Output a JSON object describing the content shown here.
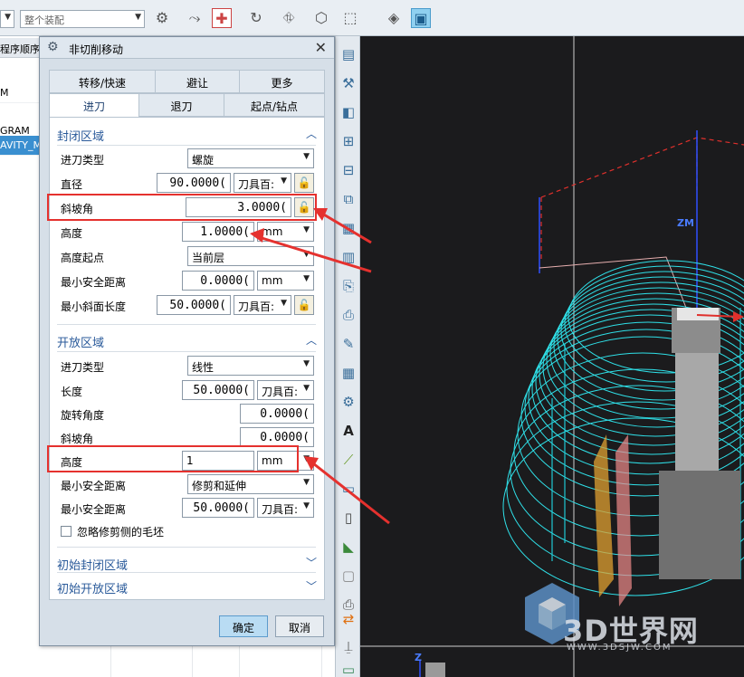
{
  "toolbar": {
    "combo_left_value": "",
    "combo_main_value": "整个装配"
  },
  "navigator": {
    "header": "程序顺序",
    "rows": [
      "M",
      "GRAM",
      "AVITY_M"
    ]
  },
  "dialog": {
    "title": "非切削移动",
    "tabs_row1": [
      "转移/快速",
      "避让",
      "更多"
    ],
    "tabs_row2": [
      "进刀",
      "退刀",
      "起点/钻点"
    ],
    "active_tab": "进刀",
    "closed_region": {
      "header": "封闭区域",
      "entry_type_label": "进刀类型",
      "entry_type_value": "螺旋",
      "diameter_label": "直径",
      "diameter_value": "90.0000(",
      "diameter_unit": "刀具百:",
      "ramp_angle_label": "斜坡角",
      "ramp_angle_value": "3.0000(",
      "height_label": "高度",
      "height_value": "1.0000(",
      "height_unit": "mm",
      "height_from_label": "高度起点",
      "height_from_value": "当前层",
      "min_safe_label": "最小安全距离",
      "min_safe_value": "0.0000(",
      "min_safe_unit": "mm",
      "min_ramp_label": "最小斜面长度",
      "min_ramp_value": "50.0000(",
      "min_ramp_unit": "刀具百:"
    },
    "open_region": {
      "header": "开放区域",
      "entry_type_label": "进刀类型",
      "entry_type_value": "线性",
      "length_label": "长度",
      "length_value": "50.0000(",
      "length_unit": "刀具百:",
      "rotation_label": "旋转角度",
      "rotation_value": "0.0000(",
      "ramp_angle_label": "斜坡角",
      "ramp_angle_value": "0.0000(",
      "height_label": "高度",
      "height_value": "1",
      "height_unit": "mm",
      "min_safe_label": "最小安全距离",
      "min_safe_value": "修剪和延伸",
      "min_safe2_label": "最小安全距离",
      "min_safe2_value": "50.0000(",
      "min_safe2_unit": "刀具百:",
      "ignore_label": "忽略修剪侧的毛坯"
    },
    "initial_closed_header": "初始封闭区域",
    "initial_open_header": "初始开放区域",
    "ok_label": "确定",
    "cancel_label": "取消"
  },
  "viewport": {
    "axis_label_zm": "ZM",
    "axis_label_z": "Z",
    "watermark": "3D世界网",
    "watermark_url": "WWW.3DSJW.COM"
  },
  "colors": {
    "highlight": "#e5312e",
    "toolpath": "#2fe0e8",
    "background_3d": "#1b1b1d"
  }
}
